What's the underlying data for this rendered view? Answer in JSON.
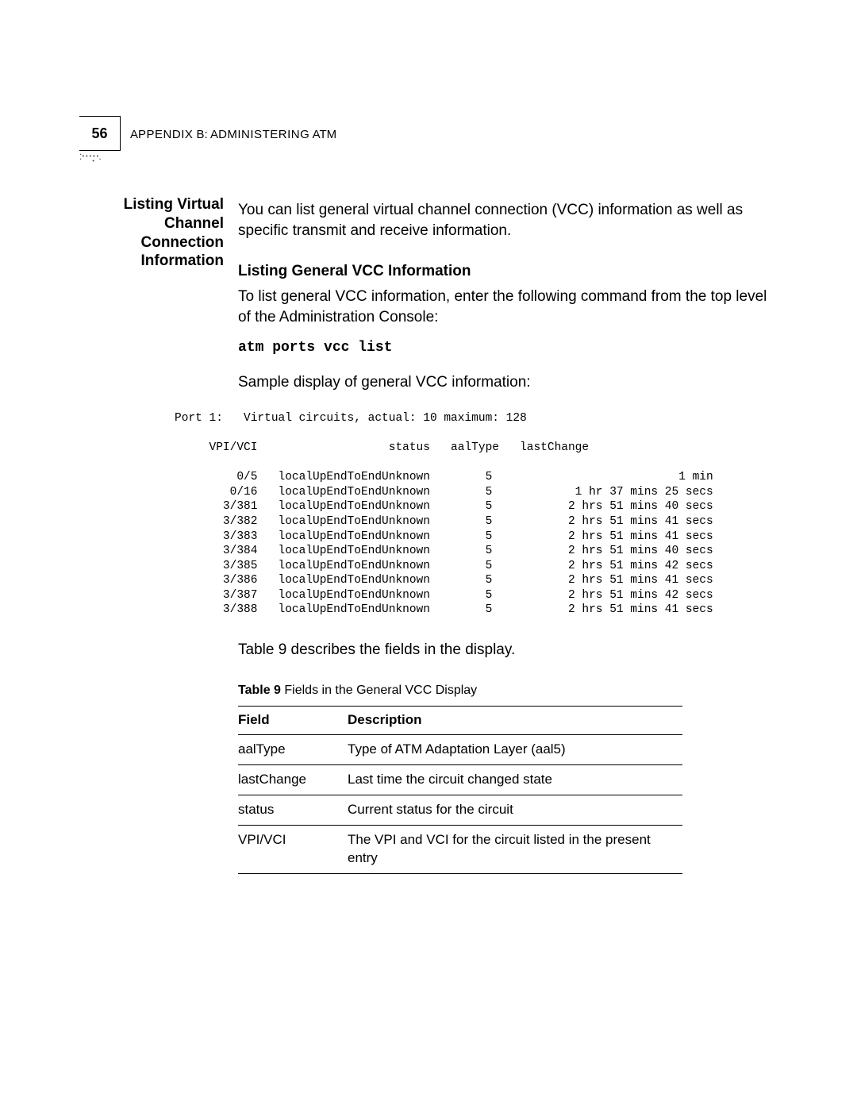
{
  "header": {
    "page_number": "56",
    "running_head_prefix": "A",
    "running_head_1": "PPENDIX",
    "running_head_mid": " B: A",
    "running_head_2": "DMINISTERING",
    "running_head_end": " ATM"
  },
  "section": {
    "side_heading": "Listing Virtual Channel Connection Information",
    "intro": "You can list general virtual channel connection (VCC) information as well as specific transmit and receive information.",
    "sub_heading": "Listing General VCC Information",
    "sub_para": "To list general VCC information, enter the following command from the top level of the Administration Console:",
    "command": "atm ports vcc list",
    "sample_label": "Sample display of general VCC information:"
  },
  "listing": {
    "port_line": "Port 1:   Virtual circuits, actual: 10 maximum: 128",
    "columns": {
      "vpi_vci": "VPI/VCI",
      "status": "status",
      "aalType": "aalType",
      "lastChange": "lastChange"
    },
    "rows": [
      {
        "vpi_vci": "0/5",
        "status": "localUpEndToEndUnknown",
        "aal": "5",
        "last": "1 min"
      },
      {
        "vpi_vci": "0/16",
        "status": "localUpEndToEndUnknown",
        "aal": "5",
        "last": "1 hr 37 mins 25 secs"
      },
      {
        "vpi_vci": "3/381",
        "status": "localUpEndToEndUnknown",
        "aal": "5",
        "last": "2 hrs 51 mins 40 secs"
      },
      {
        "vpi_vci": "3/382",
        "status": "localUpEndToEndUnknown",
        "aal": "5",
        "last": "2 hrs 51 mins 41 secs"
      },
      {
        "vpi_vci": "3/383",
        "status": "localUpEndToEndUnknown",
        "aal": "5",
        "last": "2 hrs 51 mins 41 secs"
      },
      {
        "vpi_vci": "3/384",
        "status": "localUpEndToEndUnknown",
        "aal": "5",
        "last": "2 hrs 51 mins 40 secs"
      },
      {
        "vpi_vci": "3/385",
        "status": "localUpEndToEndUnknown",
        "aal": "5",
        "last": "2 hrs 51 mins 42 secs"
      },
      {
        "vpi_vci": "3/386",
        "status": "localUpEndToEndUnknown",
        "aal": "5",
        "last": "2 hrs 51 mins 41 secs"
      },
      {
        "vpi_vci": "3/387",
        "status": "localUpEndToEndUnknown",
        "aal": "5",
        "last": "2 hrs 51 mins 42 secs"
      },
      {
        "vpi_vci": "3/388",
        "status": "localUpEndToEndUnknown",
        "aal": "5",
        "last": "2 hrs 51 mins 41 secs"
      }
    ]
  },
  "after_listing": "Table 9 describes the fields in the display.",
  "table": {
    "caption_label": "Table 9",
    "caption_rest": "   Fields in the General VCC Display",
    "head_field": "Field",
    "head_desc": "Description",
    "rows": [
      {
        "field": "aalType",
        "desc": "Type of ATM Adaptation Layer (aal5)"
      },
      {
        "field": "lastChange",
        "desc": "Last time the circuit changed state"
      },
      {
        "field": "status",
        "desc": "Current status for the circuit"
      },
      {
        "field": "VPI/VCI",
        "desc": "The VPI and VCI for the circuit listed in the present entry"
      }
    ]
  }
}
